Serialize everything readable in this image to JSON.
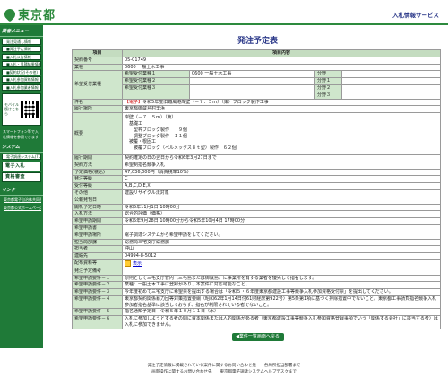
{
  "header": {
    "org": "東京都",
    "service": "入札情報サービス"
  },
  "sidebar": {
    "menu_heading": "業者メニュー",
    "menu_items": [
      "発注見通し情報",
      "■発注予定情報",
      "■入札公告情報",
      "■入札・見積結果情報",
      "■契約状況(その他)",
      "■入札参加資格情報",
      "■入札参加業者情報"
    ],
    "mobile_label": "モバイル版はこちら",
    "mobile_note": "スマートフォン等で入札情報を参照できます",
    "system_heading": "システム",
    "system_items": [
      "電子調達システム(TOP)",
      "電子入札",
      "資格審査"
    ],
    "links_heading": "リンク",
    "link_items": [
      "東京都電子自治体共同運営",
      "東京都公式ホームページ"
    ]
  },
  "main": {
    "title": "発注予定表",
    "col_item": "項目",
    "col_content": "項目内容",
    "rows": [
      {
        "label": "契約番号",
        "value": "05-01749"
      },
      {
        "label": "業種",
        "value": "0600 一般土木工事"
      },
      {
        "label": "件名",
        "prefix": "【電子】",
        "value": "令和5年度旧鐵風港岸壁（－７．５ｍ）（東）ブロック製作工事"
      },
      {
        "label": "履行場所",
        "value": "東京都御蔵島村里浜"
      },
      {
        "label": "履行期間",
        "value": "契約確定の日の翌日から令和6年3月27日まで"
      },
      {
        "label": "契約方法",
        "value": "希望制指名競争入札"
      },
      {
        "label": "予定価格(税込)",
        "value": "47,036,000円（消費税率10%）"
      },
      {
        "label": "発注等級",
        "value": "C"
      },
      {
        "label": "受付等級",
        "value": "A,B,C,D,E,X"
      },
      {
        "label": "その他",
        "value": "建設リサイクル法対象"
      },
      {
        "label": "公報発刊日",
        "value": ""
      },
      {
        "label": "開札予定日時",
        "value": "令和5年11月1日 10時00分"
      },
      {
        "label": "入札方法",
        "value": "総合的評価（価格）"
      },
      {
        "label": "希望申請期間",
        "value": "令和5年9月28日 10時00分から令和5年10月4日 17時00分"
      },
      {
        "label": "希望申請書",
        "value": ""
      },
      {
        "label": "希望申請場所",
        "value": "電子調達システムから希望申請をしてください。"
      },
      {
        "label": "担当局部課",
        "value": "総務局三宅支庁総務課"
      },
      {
        "label": "担当者",
        "value": "沖山"
      },
      {
        "label": "連絡先",
        "value": "04994-8-5012"
      },
      {
        "label": "配布資料等",
        "value": "表示"
      },
      {
        "label": "発注予定備考",
        "value": ""
      },
      {
        "label": "希望申請要件－１",
        "value": "原則として三宅支庁管内（三宅島または御蔵島）に事業所を有する業者を優先して指名します。"
      },
      {
        "label": "希望申請要件－２",
        "value": "業種：一般土木工事に登録があり、本案件に対応可能なこと。"
      },
      {
        "label": "希望申請要件－３",
        "value": "今年度初めて三宅支庁に希望票を提出する場合は「令和５・６年度東京都建設工事等競争入札参加資格受付票」を提出してください。"
      },
      {
        "label": "希望申請要件－４",
        "value": "東京都契約関係暴力団等対策措置要綱（昭和62年1月14日付61財経庶第922号）第5条第1項に基づく排除措置中でないこと。東京都工事請負指名競争入札参加者指名基準に該当しておらず、指名が制限されている者でないこと。"
      },
      {
        "label": "希望申請要件－５",
        "value": "指名通知予定日　令和５年１０月１１日（水）"
      },
      {
        "label": "希望申請要件－６",
        "value": "入札に参加しようとする者の間に資本関係または人的関係がある者（東京都建設工事等競争入札参加資格登録事項でいう「関係する会社」に該当する者）は入札に参加できません。"
      }
    ],
    "gyoshu_detail": {
      "cols": [
        "希望受付業種１",
        "0600 一般土木工事",
        "分野",
        "",
        "希望受付業種２",
        "",
        "分野１",
        "",
        "希望受付業種３",
        "",
        "分野２",
        "",
        "分野３"
      ],
      "k1": "希望受付業種１",
      "v1": "0600 一般土木工事",
      "k2": "希望受付業種２",
      "k3": "希望受付業種３",
      "bunya": "分野",
      "b1": "分野１",
      "b2": "分野２",
      "b3": "分野３"
    },
    "outline": {
      "label": "概要",
      "lines": [
        "岸壁（－７．５ｍ）（東）",
        "　基礎工",
        "　　型枠ブロック製作　　９個",
        "　　調整ブロック製作　１１個",
        "　被覆・根固工",
        "　　被覆ブロック（ペルメックス８ｔ型）製作　６２個"
      ]
    },
    "kibo_label": "希望受付業種",
    "back_button": "◀業件一覧画面へ戻る"
  },
  "footer": {
    "line1": "発注予定情報に掲載されている案件に関するお問い合わせ先　　各局所担当部署まで",
    "line2": "画面操作に関するお問い合わせ先　　東京都電子調達システムヘルプデスクまで"
  }
}
